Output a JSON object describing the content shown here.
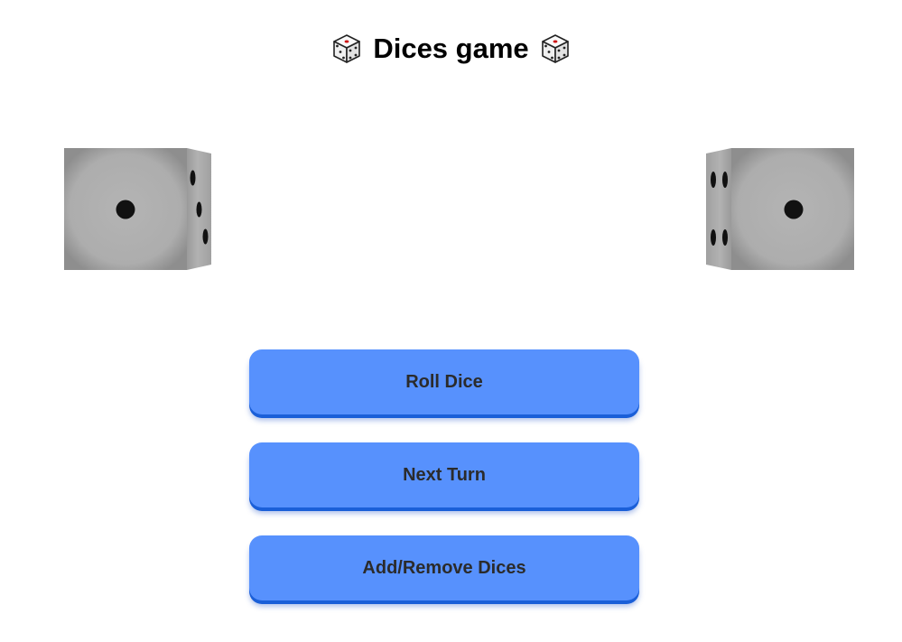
{
  "header": {
    "title": "Dices game",
    "left_icon": "die-icon",
    "right_icon": "die-icon"
  },
  "dice": [
    {
      "front_face": 1,
      "side_face": 3
    },
    {
      "front_face": 1,
      "side_face": 4
    }
  ],
  "buttons": {
    "roll_label": "Roll Dice",
    "next_label": "Next Turn",
    "add_remove_label": "Add/Remove Dices"
  },
  "colors": {
    "button_bg": "#5791fd",
    "button_shadow": "#1a5fd8",
    "die_face": "#b0b0b0",
    "pip": "#111111"
  }
}
